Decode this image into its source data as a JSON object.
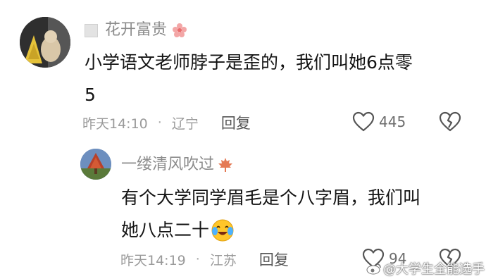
{
  "comment": {
    "username": "花开富贵",
    "text_line1": "小学语文老师脖子是歪的，我们叫她6点零",
    "text_line2": "5",
    "time": "昨天14:10",
    "dot": "·",
    "location": "辽宁",
    "reply_label": "回复",
    "likes": "445"
  },
  "reply": {
    "username": "一缕清风吹过",
    "text_line1": "有个大学同学眉毛是个八字眉，我们叫",
    "text_line2": "她八点二十",
    "time": "昨天14:19",
    "dot": "·",
    "location": "江苏",
    "reply_label": "回复",
    "likes": "94"
  },
  "watermark": "@大学生全能选手"
}
